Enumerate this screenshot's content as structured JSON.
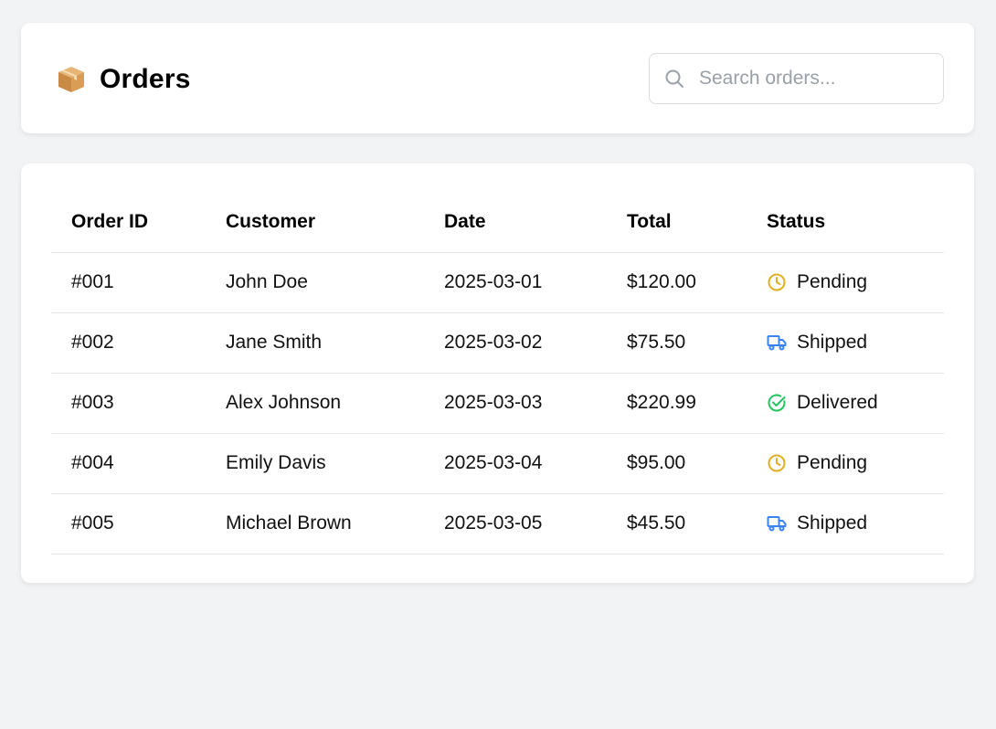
{
  "header": {
    "title": "Orders",
    "title_icon": "package-icon"
  },
  "search": {
    "placeholder": "Search orders...",
    "value": "",
    "icon": "search-icon"
  },
  "table": {
    "columns": [
      "Order ID",
      "Customer",
      "Date",
      "Total",
      "Status"
    ],
    "rows": [
      {
        "id": "#001",
        "customer": "John Doe",
        "date": "2025-03-01",
        "total": "$120.00",
        "status": "Pending",
        "status_icon": "clock-icon"
      },
      {
        "id": "#002",
        "customer": "Jane Smith",
        "date": "2025-03-02",
        "total": "$75.50",
        "status": "Shipped",
        "status_icon": "truck-icon"
      },
      {
        "id": "#003",
        "customer": "Alex Johnson",
        "date": "2025-03-03",
        "total": "$220.99",
        "status": "Delivered",
        "status_icon": "check-circle-icon"
      },
      {
        "id": "#004",
        "customer": "Emily Davis",
        "date": "2025-03-04",
        "total": "$95.00",
        "status": "Pending",
        "status_icon": "clock-icon"
      },
      {
        "id": "#005",
        "customer": "Michael Brown",
        "date": "2025-03-05",
        "total": "$45.50",
        "status": "Shipped",
        "status_icon": "truck-icon"
      }
    ]
  },
  "colors": {
    "page_bg": "#f2f3f5",
    "card_bg": "#ffffff",
    "pending": "#e0b022",
    "shipped": "#3b82f6",
    "delivered": "#22c55e",
    "border": "#e3e5e8"
  }
}
